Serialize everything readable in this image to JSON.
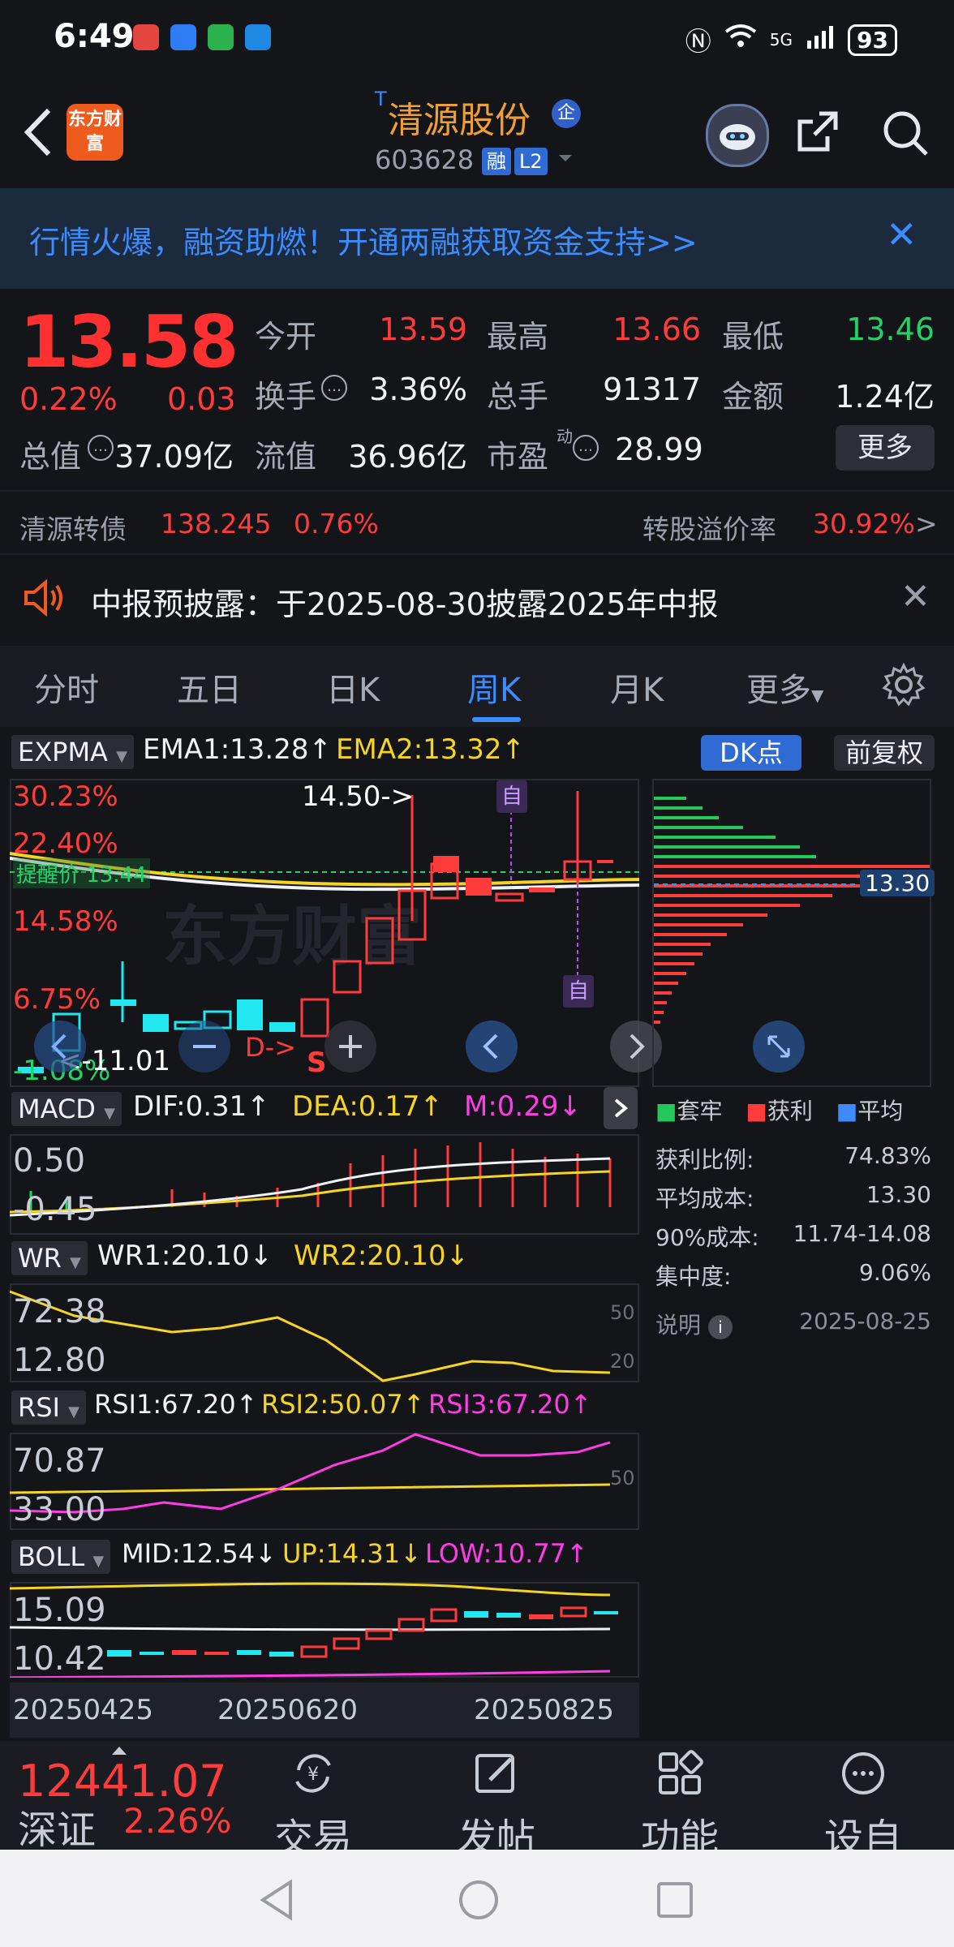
{
  "status": {
    "time": "6:49",
    "battery": "93",
    "network": "5G"
  },
  "header": {
    "logo_text": "东方财富",
    "stock_name": "清源股份",
    "name_prefix": "T",
    "enterprise_badge": "企",
    "stock_code": "603628",
    "tags": [
      "融",
      "L2"
    ]
  },
  "banner": {
    "text": "行情火爆，融资助燃！开通两融获取资金支持>>"
  },
  "quote": {
    "price": "13.58",
    "change_pct": "0.22%",
    "change": "0.03",
    "open_label": "今开",
    "open": "13.59",
    "high_label": "最高",
    "high": "13.66",
    "low_label": "最低",
    "low": "13.46",
    "turnover_label": "换手",
    "turnover": "3.36%",
    "volume_label": "总手",
    "volume": "91317",
    "amount_label": "金额",
    "amount": "1.24亿",
    "mktcap_label": "总值",
    "mktcap": "37.09亿",
    "float_label": "流值",
    "float_cap": "36.96亿",
    "pe_label": "市盈",
    "pe_sup": "动",
    "pe": "28.99",
    "more_label": "更多"
  },
  "convertible": {
    "name": "清源转债",
    "price": "138.245",
    "change": "0.76%",
    "premium_label": "转股溢价率",
    "premium": "30.92%",
    "arrow": ">"
  },
  "notice": {
    "text": "中报预披露：于2025-08-30披露2025年中报"
  },
  "tabs": [
    "分时",
    "五日",
    "日K",
    "周K",
    "月K",
    "更多"
  ],
  "active_tab": "周K",
  "kline": {
    "indicator": "EXPMA",
    "ema1": "EMA1:13.28↑",
    "ema2": "EMA2:13.32↑",
    "dk_label": "DK点",
    "adjust_label": "前复权",
    "y_labels": [
      "30.23%",
      "22.40%",
      "14.58%",
      "6.75%",
      "-1.08%"
    ],
    "high_marker": "14.50->",
    "low_marker": "<-11.01",
    "alert_label": "提醒价 13.44",
    "ds_label": "D->",
    "s_label": "S",
    "self_label": "自",
    "watermark": "东方财富"
  },
  "chips": {
    "cost_marker": "13.30",
    "legend": [
      "套牢",
      "获利",
      "平均"
    ],
    "rows": [
      {
        "label": "获利比例:",
        "value": "74.83%"
      },
      {
        "label": "平均成本:",
        "value": "13.30"
      },
      {
        "label": "90%成本:",
        "value": "11.74-14.08"
      },
      {
        "label": "集中度:",
        "value": "9.06%"
      }
    ],
    "note_label": "说明",
    "date": "2025-08-25"
  },
  "macd": {
    "name": "MACD",
    "dif": "DIF:0.31↑",
    "dea": "DEA:0.17↑",
    "m": "M:0.29↓",
    "top": "0.50",
    "bottom": "-0.45"
  },
  "wr": {
    "name": "WR",
    "wr1": "WR1:20.10↓",
    "wr2": "WR2:20.10↓",
    "top": "72.38",
    "bottom": "12.80",
    "mark50": "50",
    "mark20": "20"
  },
  "rsi": {
    "name": "RSI",
    "rsi1": "RSI1:67.20↑",
    "rsi2": "RSI2:50.07↑",
    "rsi3": "RSI3:67.20↑",
    "top": "70.87",
    "bottom": "33.00",
    "mark50": "50"
  },
  "boll": {
    "name": "BOLL",
    "mid": "MID:12.54↓",
    "up": "UP:14.31↓",
    "low": "LOW:10.77↑",
    "top": "15.09",
    "bottom": "10.42"
  },
  "dates": [
    "20250425",
    "20250620",
    "20250825"
  ],
  "bottom": {
    "index_value": "12441.07",
    "index_name": "深证",
    "index_change": "2.26%",
    "nav": [
      "交易",
      "发帖",
      "功能",
      "设自选"
    ]
  },
  "colors": {
    "up": "#ff3b3b",
    "down": "#22d36a",
    "accent": "#3d8cff",
    "brand": "#ef5a1d"
  }
}
